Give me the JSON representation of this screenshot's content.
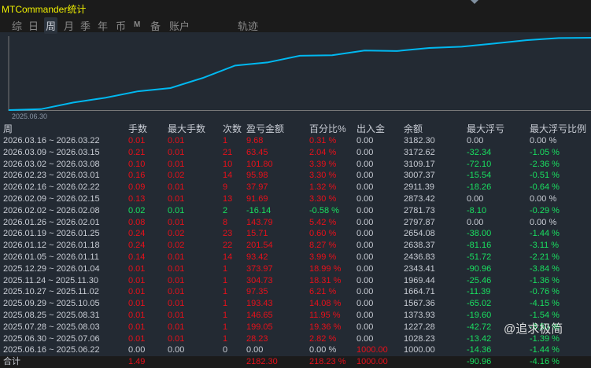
{
  "title": "MTCommander统计",
  "tabs": [
    "综",
    "日",
    "周",
    "月",
    "季",
    "年",
    "币",
    "M",
    "备",
    "账户",
    "轨迹"
  ],
  "active_tab": "周",
  "chart": {
    "start_label": "2025.06.30",
    "line_color": "#00b8f0",
    "balance": [
      1000.0,
      1028.23,
      1227.28,
      1373.93,
      1567.36,
      1664.71,
      1969.44,
      2343.41,
      2436.83,
      2638.37,
      2654.08,
      2797.87,
      2781.73,
      2873.42,
      2911.39,
      3007.37,
      3109.17,
      3172.62,
      3182.3
    ]
  },
  "headers": [
    "周",
    "手数",
    "最大手数",
    "次数",
    "盈亏金额",
    "百分比%",
    "出入金",
    "余额",
    "最大浮亏",
    "最大浮亏比例"
  ],
  "rows": [
    [
      "2026.03.16 ~ 2026.03.22",
      "0.01",
      "0.01",
      "1",
      "9.68",
      "0.31 %",
      "0.00",
      "3182.30",
      "0.00",
      "0.00 %"
    ],
    [
      "2026.03.09 ~ 2026.03.15",
      "0.21",
      "0.01",
      "21",
      "63.45",
      "2.04 %",
      "0.00",
      "3172.62",
      "-32.34",
      "-1.05 %"
    ],
    [
      "2026.03.02 ~ 2026.03.08",
      "0.10",
      "0.01",
      "10",
      "101.80",
      "3.39 %",
      "0.00",
      "3109.17",
      "-72.10",
      "-2.36 %"
    ],
    [
      "2026.02.23 ~ 2026.03.01",
      "0.16",
      "0.02",
      "14",
      "95.98",
      "3.30 %",
      "0.00",
      "3007.37",
      "-15.54",
      "-0.51 %"
    ],
    [
      "2026.02.16 ~ 2026.02.22",
      "0.09",
      "0.01",
      "9",
      "37.97",
      "1.32 %",
      "0.00",
      "2911.39",
      "-18.26",
      "-0.64 %"
    ],
    [
      "2026.02.09 ~ 2026.02.15",
      "0.13",
      "0.01",
      "13",
      "91.69",
      "3.30 %",
      "0.00",
      "2873.42",
      "0.00",
      "0.00 %"
    ],
    [
      "2026.02.02 ~ 2026.02.08",
      "0.02",
      "0.01",
      "2",
      "-16.14",
      "-0.58 %",
      "0.00",
      "2781.73",
      "-8.10",
      "-0.29 %"
    ],
    [
      "2026.01.26 ~ 2026.02.01",
      "0.08",
      "0.01",
      "8",
      "143.79",
      "5.42 %",
      "0.00",
      "2797.87",
      "0.00",
      "0.00 %"
    ],
    [
      "2026.01.19 ~ 2026.01.25",
      "0.24",
      "0.02",
      "23",
      "15.71",
      "0.60 %",
      "0.00",
      "2654.08",
      "-38.00",
      "-1.44 %"
    ],
    [
      "2026.01.12 ~ 2026.01.18",
      "0.24",
      "0.02",
      "22",
      "201.54",
      "8.27 %",
      "0.00",
      "2638.37",
      "-81.16",
      "-3.11 %"
    ],
    [
      "2026.01.05 ~ 2026.01.11",
      "0.14",
      "0.01",
      "14",
      "93.42",
      "3.99 %",
      "0.00",
      "2436.83",
      "-51.72",
      "-2.21 %"
    ],
    [
      "2025.12.29 ~ 2026.01.04",
      "0.01",
      "0.01",
      "1",
      "373.97",
      "18.99 %",
      "0.00",
      "2343.41",
      "-90.96",
      "-3.84 %"
    ],
    [
      "2025.11.24 ~ 2025.11.30",
      "0.01",
      "0.01",
      "1",
      "304.73",
      "18.31 %",
      "0.00",
      "1969.44",
      "-25.46",
      "-1.36 %"
    ],
    [
      "2025.10.27 ~ 2025.11.02",
      "0.01",
      "0.01",
      "1",
      "97.35",
      "6.21 %",
      "0.00",
      "1664.71",
      "-11.39",
      "-0.76 %"
    ],
    [
      "2025.09.29 ~ 2025.10.05",
      "0.01",
      "0.01",
      "1",
      "193.43",
      "14.08 %",
      "0.00",
      "1567.36",
      "-65.02",
      "-4.15 %"
    ],
    [
      "2025.08.25 ~ 2025.08.31",
      "0.01",
      "0.01",
      "1",
      "146.65",
      "11.95 %",
      "0.00",
      "1373.93",
      "-19.60",
      "-1.54 %"
    ],
    [
      "2025.07.28 ~ 2025.08.03",
      "0.01",
      "0.01",
      "1",
      "199.05",
      "19.36 %",
      "0.00",
      "1227.28",
      "-42.72",
      "-3.50 %"
    ],
    [
      "2025.06.30 ~ 2025.07.06",
      "0.01",
      "0.01",
      "1",
      "28.23",
      "2.82 %",
      "0.00",
      "1028.23",
      "-13.42",
      "-1.39 %"
    ],
    [
      "2025.06.16 ~ 2025.06.22",
      "0.00",
      "0.00",
      "0",
      "0.00",
      "0.00 %",
      "1000.00",
      "1000.00",
      "-14.36",
      "-1.44 %"
    ]
  ],
  "total": [
    "合计",
    "1.49",
    "",
    "",
    "2182.30",
    "218.23 %",
    "1000.00",
    "",
    "-90.96",
    "-4.16 %"
  ],
  "watermark": "@追求极简",
  "colors": {
    "profit": "#e8101a",
    "loss": "#19e060",
    "neutral": "#c8ccd4"
  }
}
